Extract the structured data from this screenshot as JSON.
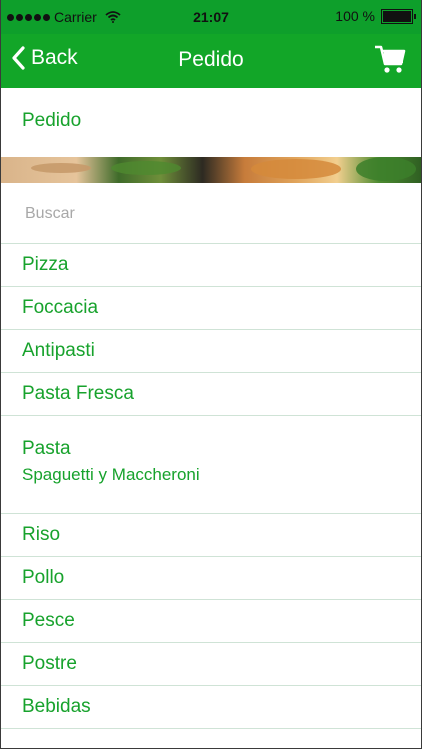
{
  "status_bar": {
    "carrier": "Carrier",
    "time": "21:07",
    "battery": "100 %"
  },
  "nav": {
    "back_label": "Back",
    "title": "Pedido",
    "right_icon": "cart-icon"
  },
  "header": {
    "label": "Pedido"
  },
  "search": {
    "placeholder": "Buscar"
  },
  "menu": {
    "items": [
      {
        "label": "Pizza"
      },
      {
        "label": "Foccacia"
      },
      {
        "label": "Antipasti"
      },
      {
        "label": "Pasta Fresca"
      },
      {
        "label": "Pasta",
        "sub": "Spaguetti y Maccheroni"
      },
      {
        "label": "Riso"
      },
      {
        "label": "Pollo"
      },
      {
        "label": "Pesce"
      },
      {
        "label": "Postre"
      },
      {
        "label": "Bebidas"
      }
    ]
  },
  "colors": {
    "accent": "#12a628",
    "text_green": "#17a22c",
    "separator": "#cfe3d6"
  }
}
